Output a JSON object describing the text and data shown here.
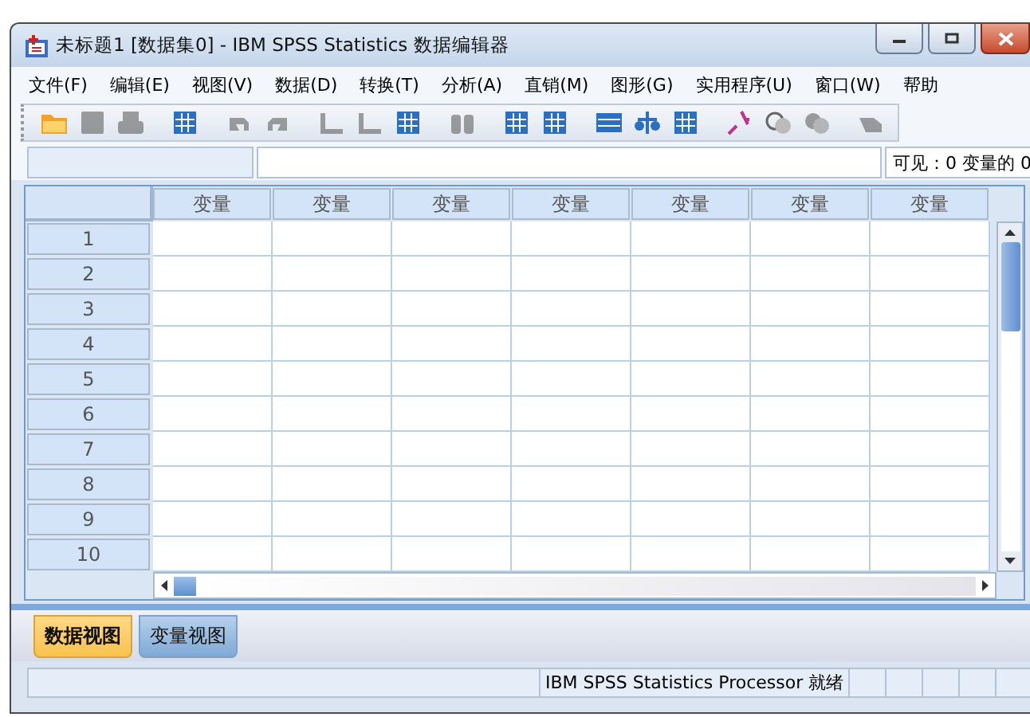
{
  "window": {
    "title": "未标题1 [数据集0] - IBM SPSS Statistics 数据编辑器"
  },
  "menu": [
    "文件(F)",
    "编辑(E)",
    "视图(V)",
    "数据(D)",
    "转换(T)",
    "分析(A)",
    "直销(M)",
    "图形(G)",
    "实用程序(U)",
    "窗口(W)",
    "帮助"
  ],
  "toolbar": [
    {
      "disabled": false
    },
    {
      "disabled": true
    },
    {
      "disabled": true
    },
    {
      "disabled": false
    },
    {
      "disabled": true
    },
    {
      "disabled": true
    },
    {
      "disabled": true
    },
    {
      "disabled": true
    },
    {
      "disabled": false
    },
    {
      "disabled": true
    },
    {
      "disabled": false
    },
    {
      "disabled": false
    },
    {
      "disabled": false
    },
    {
      "disabled": false
    },
    {
      "disabled": false
    },
    {
      "disabled": false
    },
    {
      "disabled": false
    },
    {
      "disabled": true
    },
    {
      "disabled": true
    }
  ],
  "cell_bar": {
    "visible_count": "可见：0 变量的 0"
  },
  "grid": {
    "columns": [
      "变量",
      "变量",
      "变量",
      "变量",
      "变量",
      "变量",
      "变量"
    ],
    "rows": [
      "1",
      "2",
      "3",
      "4",
      "5",
      "6",
      "7",
      "8",
      "9",
      "10"
    ]
  },
  "tabs": [
    {
      "label": "数据视图",
      "selected": true
    },
    {
      "label": "变量视图",
      "selected": false
    }
  ],
  "status_bar": {
    "message": "IBM SPSS Statistics Processor 就绪"
  }
}
